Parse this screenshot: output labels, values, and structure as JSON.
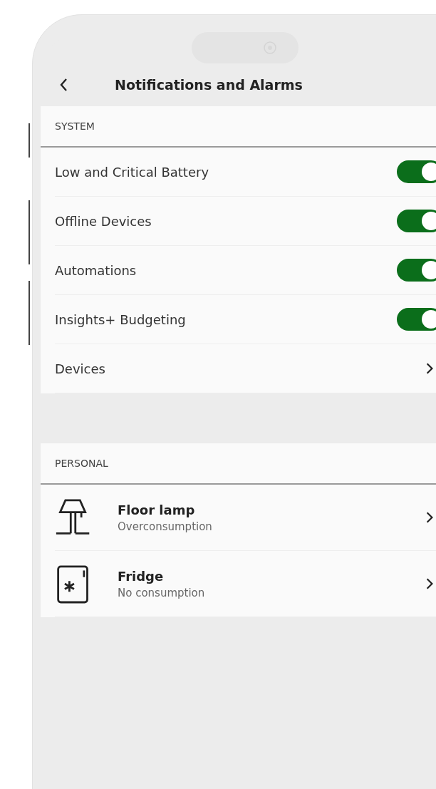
{
  "header": {
    "title": "Notifications and Alarms"
  },
  "sections": [
    {
      "title": "SYSTEM",
      "items": [
        {
          "kind": "toggle",
          "label": "Low and Critical Battery",
          "on": true
        },
        {
          "kind": "toggle",
          "label": "Offline Devices",
          "on": true
        },
        {
          "kind": "toggle",
          "label": "Automations",
          "on": true
        },
        {
          "kind": "toggle",
          "label": "Insights+ Budgeting",
          "on": true
        },
        {
          "kind": "link",
          "label": "Devices"
        }
      ]
    },
    {
      "title": "PERSONAL",
      "items": [
        {
          "kind": "lamp",
          "label": "Floor lamp",
          "subtitle": "Overconsumption"
        },
        {
          "kind": "fridge",
          "label": "Fridge",
          "subtitle": "No consumption"
        }
      ]
    }
  ]
}
